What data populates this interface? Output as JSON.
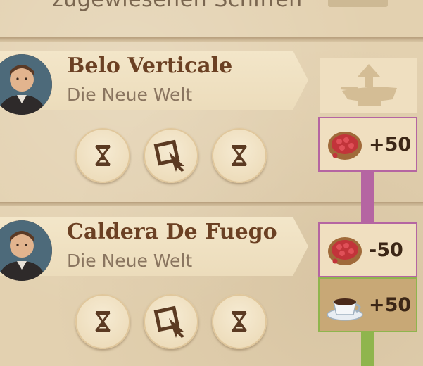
{
  "header": {
    "partial_text": "zugewiesenen Schiffen"
  },
  "ships": [
    {
      "name": "Belo Verticale",
      "region": "Die Neue Welt",
      "actions": [
        "hourglass-icon",
        "cargo-edit-icon",
        "hourglass-icon"
      ],
      "resource": {
        "icon": "coffee-beans-icon",
        "amount": "+50"
      }
    },
    {
      "name": "Caldera De Fuego",
      "region": "Die Neue Welt",
      "actions": [
        "hourglass-icon",
        "cargo-edit-icon",
        "hourglass-icon"
      ],
      "resources": [
        {
          "icon": "coffee-beans-icon",
          "amount": "-50"
        },
        {
          "icon": "coffee-cup-icon",
          "amount": "+50"
        }
      ]
    }
  ],
  "route": {
    "unload_icon": "ship-unload-icon"
  },
  "colors": {
    "route_purple": "#b565a2",
    "route_green": "#8fb54d",
    "name_brown": "#6b4023"
  }
}
